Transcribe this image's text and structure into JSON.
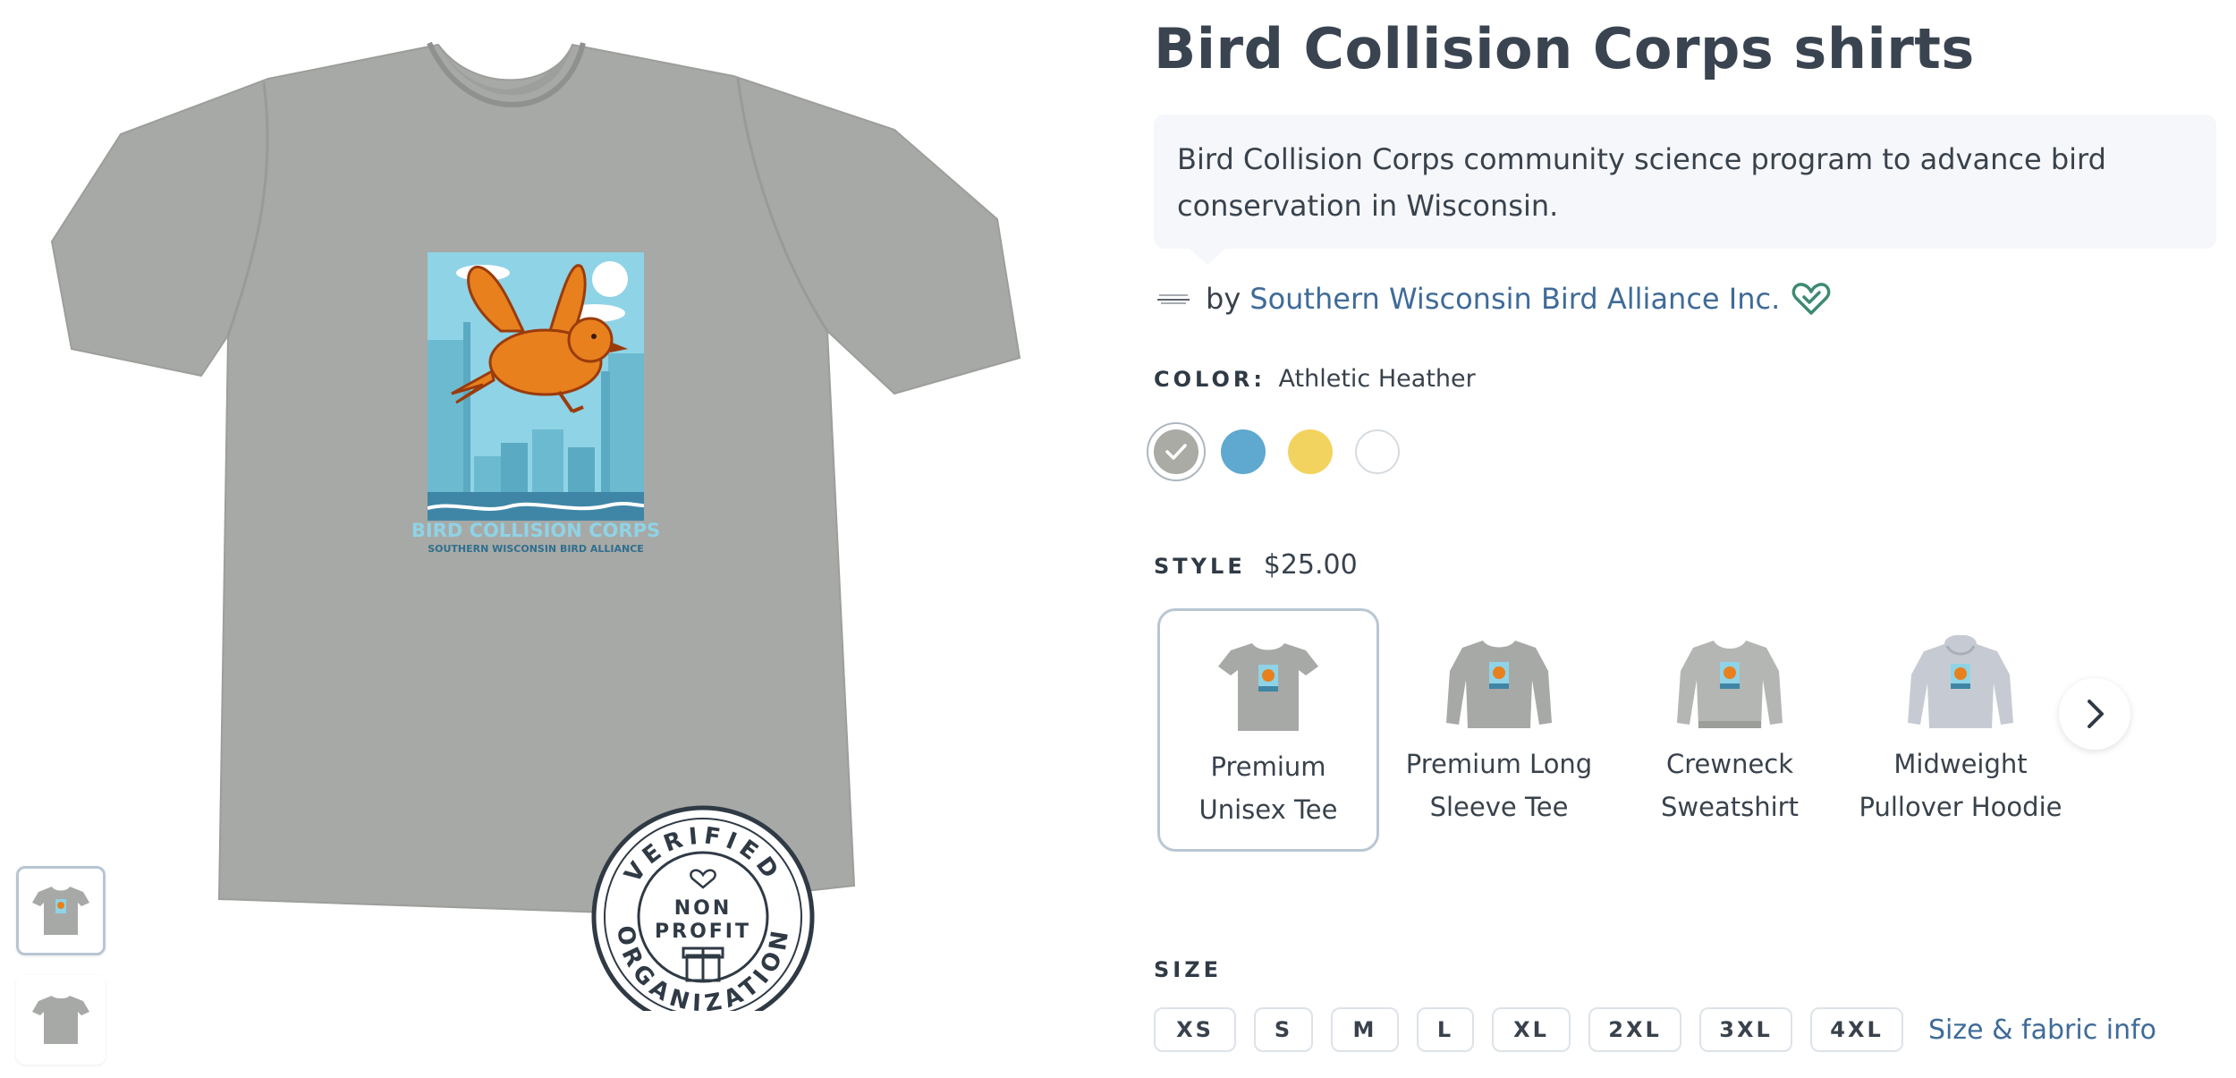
{
  "product": {
    "title": "Bird Collision Corps shirts",
    "description": "Bird Collision Corps community science program to advance bird conservation in Wisconsin.",
    "shirt_print": {
      "line1": "BIRD COLLISION CORPS",
      "line2": "SOUTHERN WISCONSIN BIRD ALLIANCE"
    },
    "badge": {
      "top_text": "VERIFIED",
      "bottom_text": "ORGANIZATION",
      "line1": "NON",
      "line2": "PROFIT"
    }
  },
  "seller": {
    "by_label": "by",
    "name": "Southern Wisconsin Bird Alliance Inc."
  },
  "color": {
    "label": "COLOR:",
    "value": "Athletic Heather",
    "swatches": [
      {
        "name": "Athletic Heather",
        "hex": "#a9aba4",
        "selected": true
      },
      {
        "name": "Blue",
        "hex": "#5fa8cf",
        "selected": false
      },
      {
        "name": "Yellow",
        "hex": "#f3d35f",
        "selected": false
      },
      {
        "name": "White",
        "hex": "#ffffff",
        "selected": false
      }
    ]
  },
  "style": {
    "label": "STYLE",
    "price": "$25.00",
    "options": [
      {
        "name": "Premium Unisex Tee",
        "selected": true
      },
      {
        "name": "Premium Long Sleeve Tee",
        "selected": false
      },
      {
        "name": "Crewneck Sweatshirt",
        "selected": false
      },
      {
        "name": "Midweight Pullover Hoodie",
        "selected": false
      }
    ]
  },
  "size": {
    "label": "SIZE",
    "options": [
      "XS",
      "S",
      "M",
      "L",
      "XL",
      "2XL",
      "3XL",
      "4XL"
    ],
    "info_link": "Size & fabric info"
  },
  "colors": {
    "heather": "#a9aba4",
    "link": "#3f6b99",
    "heart": "#3d8a74",
    "bird": "#e8801e",
    "sky": "#8fd3e6"
  }
}
